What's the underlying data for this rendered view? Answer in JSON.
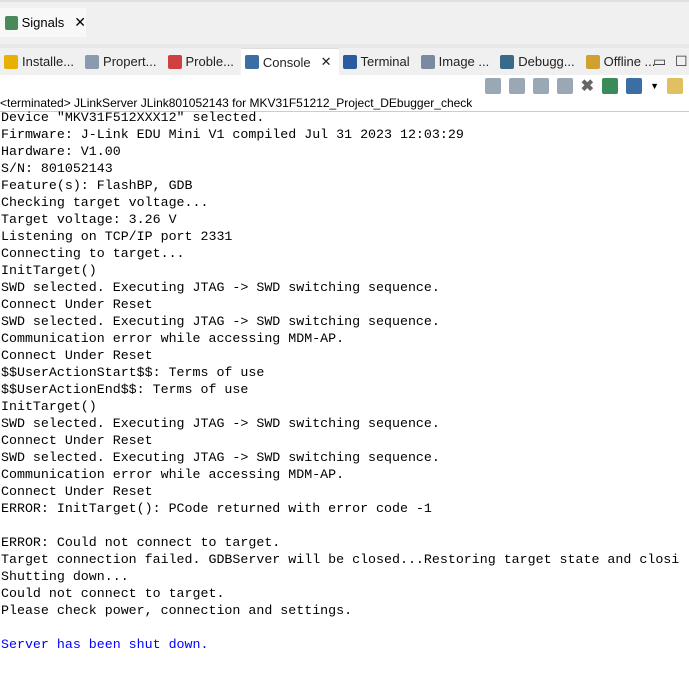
{
  "top_tab": {
    "label": "Signals",
    "icon": "signals-icon"
  },
  "tabs": [
    {
      "label": "Installe...",
      "icon": "cylinder-icon",
      "color": "#e8b000"
    },
    {
      "label": "Propert...",
      "icon": "table-icon",
      "color": "#8a9bb0"
    },
    {
      "label": "Proble...",
      "icon": "problems-icon",
      "color": "#d04040"
    },
    {
      "label": "Console",
      "icon": "console-icon",
      "color": "#3a6ea5",
      "active": true
    },
    {
      "label": "Terminal",
      "icon": "terminal-icon",
      "color": "#2a5aa0"
    },
    {
      "label": "Image ...",
      "icon": "image-icon",
      "color": "#7a8aa0"
    },
    {
      "label": "Debugg...",
      "icon": "debugger-icon",
      "color": "#3a6a8a"
    },
    {
      "label": "Offline ...",
      "icon": "offline-icon",
      "color": "#d0a030"
    }
  ],
  "console_title": "<terminated> JLinkServer JLink801052143 for MKV31F51212_Project_DEbugger_check",
  "lines": [
    "Device \"MKV31F512XXX12\" selected.",
    "Firmware: J-Link EDU Mini V1 compiled Jul 31 2023 12:03:29",
    "Hardware: V1.00",
    "S/N: 801052143",
    "Feature(s): FlashBP, GDB",
    "Checking target voltage...",
    "Target voltage: 3.26 V",
    "Listening on TCP/IP port 2331",
    "Connecting to target...",
    "InitTarget()",
    "SWD selected. Executing JTAG -> SWD switching sequence.",
    "Connect Under Reset",
    "SWD selected. Executing JTAG -> SWD switching sequence.",
    "Communication error while accessing MDM-AP.",
    "Connect Under Reset",
    "$$UserActionStart$$: Terms of use",
    "$$UserActionEnd$$: Terms of use",
    "InitTarget()",
    "SWD selected. Executing JTAG -> SWD switching sequence.",
    "Connect Under Reset",
    "SWD selected. Executing JTAG -> SWD switching sequence.",
    "Communication error while accessing MDM-AP.",
    "Connect Under Reset",
    "ERROR: InitTarget(): PCode returned with error code -1",
    "",
    "ERROR: Could not connect to target.",
    "Target connection failed. GDBServer will be closed...Restoring target state and closi",
    "Shutting down...",
    "Could not connect to target.",
    "Please check power, connection and settings.",
    ""
  ],
  "final_line": "Server has been shut down."
}
